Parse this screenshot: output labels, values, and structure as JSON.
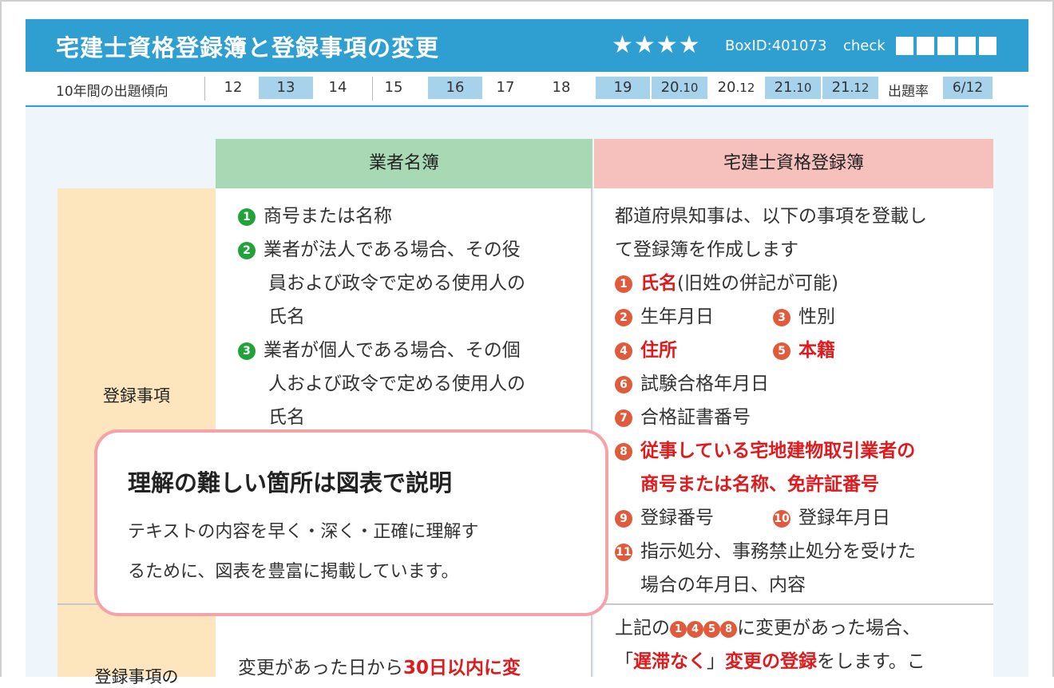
{
  "header": {
    "title": "宅建士資格登録簿と登録事項の変更",
    "stars": "★★★★",
    "box_id": "BoxID:401073",
    "check_label": "check",
    "check_box_count": 5
  },
  "frequency": {
    "label": "10年間の出題傾向",
    "years": [
      {
        "main": "12",
        "sub": "",
        "highlighted": false
      },
      {
        "main": "13",
        "sub": "",
        "highlighted": true
      },
      {
        "main": "14",
        "sub": "",
        "highlighted": false
      },
      {
        "main": "15",
        "sub": "",
        "highlighted": false
      },
      {
        "main": "16",
        "sub": "",
        "highlighted": true
      },
      {
        "main": "17",
        "sub": "",
        "highlighted": false
      },
      {
        "main": "18",
        "sub": "",
        "highlighted": false
      },
      {
        "main": "19",
        "sub": "",
        "highlighted": true
      },
      {
        "main": "20",
        "sub": ".10",
        "highlighted": true
      },
      {
        "main": "20",
        "sub": ".12",
        "highlighted": false
      },
      {
        "main": "21",
        "sub": ".10",
        "highlighted": true
      },
      {
        "main": "21",
        "sub": ".12",
        "highlighted": true
      }
    ],
    "rate_label": "出題率",
    "rate_value": "6/12"
  },
  "table": {
    "col_gyosha": "業者名簿",
    "col_shikaku": "宅建士資格登録簿",
    "row1_label": "登録事項",
    "row2_label": "登録事項の",
    "gyosha_items": {
      "i1_num": "1",
      "i1_line1": "商号または名称",
      "i2_num": "2",
      "i2_line1": "業者が法人である場合、その役",
      "i2_line2": "員および政令で定める使用人の",
      "i2_line3": "氏名",
      "i3_num": "3",
      "i3_line1": "業者が個人である場合、その個",
      "i3_line2": "人および政令で定める使用人の",
      "i3_line3": "氏名"
    },
    "shikaku_items": {
      "intro1": "都道府県知事は、以下の事項を登載し",
      "intro2": "て登録簿を作成します",
      "n1": "1",
      "t1_red": "氏名",
      "t1_note": "(旧姓の併記が可能)",
      "n2": "2",
      "t2": "生年月日",
      "n3": "3",
      "t3": "性別",
      "n4": "4",
      "t4_red": "住所",
      "n5": "5",
      "t5_red": "本籍",
      "n6": "6",
      "t6": "試験合格年月日",
      "n7": "7",
      "t7": "合格証書番号",
      "n8": "8",
      "t8_red1": "従事している宅地建物取引業者の",
      "t8_red2": "商号または名称、免許証番号",
      "n9": "9",
      "t9": "登録番号",
      "n10": "10",
      "t10": "登録年月日",
      "n11": "11",
      "t11_line1": "指示処分、事務禁止処分を受けた",
      "t11_line2": "場合の年月日、内容"
    },
    "row2_gyosha_pre": "変更があった日から",
    "row2_gyosha_red": "30日以内に変",
    "row2_shikaku": {
      "pre": "上記の",
      "nums": [
        "1",
        "4",
        "5",
        "8"
      ],
      "post": "に変更があった場合、",
      "open_q": "「",
      "red1": "遅滞なく",
      "close_q": "」",
      "red2": "変更の登録",
      "tail": "をします。こ"
    }
  },
  "callout": {
    "title": "理解の難しい箇所は図表で説明",
    "body_line1": "テキストの内容を早く・深く・正確に理解す",
    "body_line2": "るために、図表を豊富に掲載しています。"
  },
  "colors": {
    "header_blue": "#2e9fd0",
    "highlight_blue": "#a7d2eb",
    "gyosha_green": "#a9d8b5",
    "shikaku_pink": "#f6c0bd",
    "rowhead_cream": "#fde6bd",
    "accent_red": "#e0191c",
    "callout_border": "#f5a3a8"
  }
}
